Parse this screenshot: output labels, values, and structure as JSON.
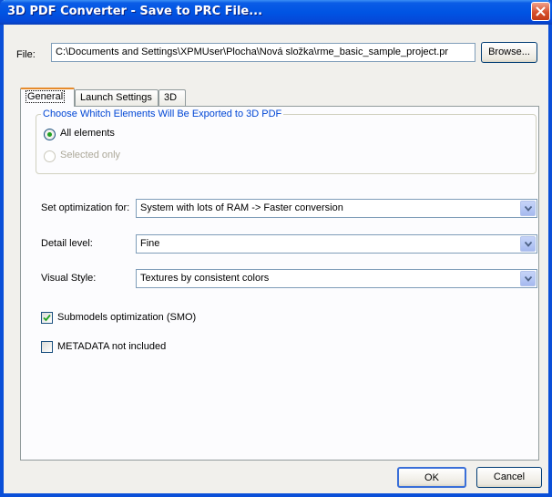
{
  "window": {
    "title": "3D PDF Converter - Save to PRC File..."
  },
  "file": {
    "label": "File:",
    "path": "C:\\Documents and Settings\\XPMUser\\Plocha\\Nová složka\\rme_basic_sample_project.pr",
    "browse_label": "Browse..."
  },
  "tabs": [
    {
      "label": "General",
      "active": true
    },
    {
      "label": "Launch Settings",
      "active": false
    },
    {
      "label": "3D",
      "active": false
    }
  ],
  "export_group": {
    "title": "Choose Whitch Elements Will Be Exported to 3D PDF",
    "options": [
      {
        "label": "All elements",
        "selected": true,
        "enabled": true
      },
      {
        "label": "Selected only",
        "selected": false,
        "enabled": false
      }
    ]
  },
  "settings": [
    {
      "label": "Set optimization for:",
      "value": "System with lots of RAM -> Faster conversion"
    },
    {
      "label": "Detail level:",
      "value": "Fine"
    },
    {
      "label": "Visual Style:",
      "value": "Textures by consistent colors"
    }
  ],
  "checkboxes": [
    {
      "label": "Submodels optimization (SMO)",
      "checked": true
    },
    {
      "label": "METADATA not included",
      "checked": false
    }
  ],
  "buttons": {
    "ok": "OK",
    "cancel": "Cancel"
  },
  "colors": {
    "title_bar": "#0054e3",
    "group_title": "#0046d5",
    "tab_highlight": "#e68b2c",
    "radio_dot": "#21a121"
  }
}
